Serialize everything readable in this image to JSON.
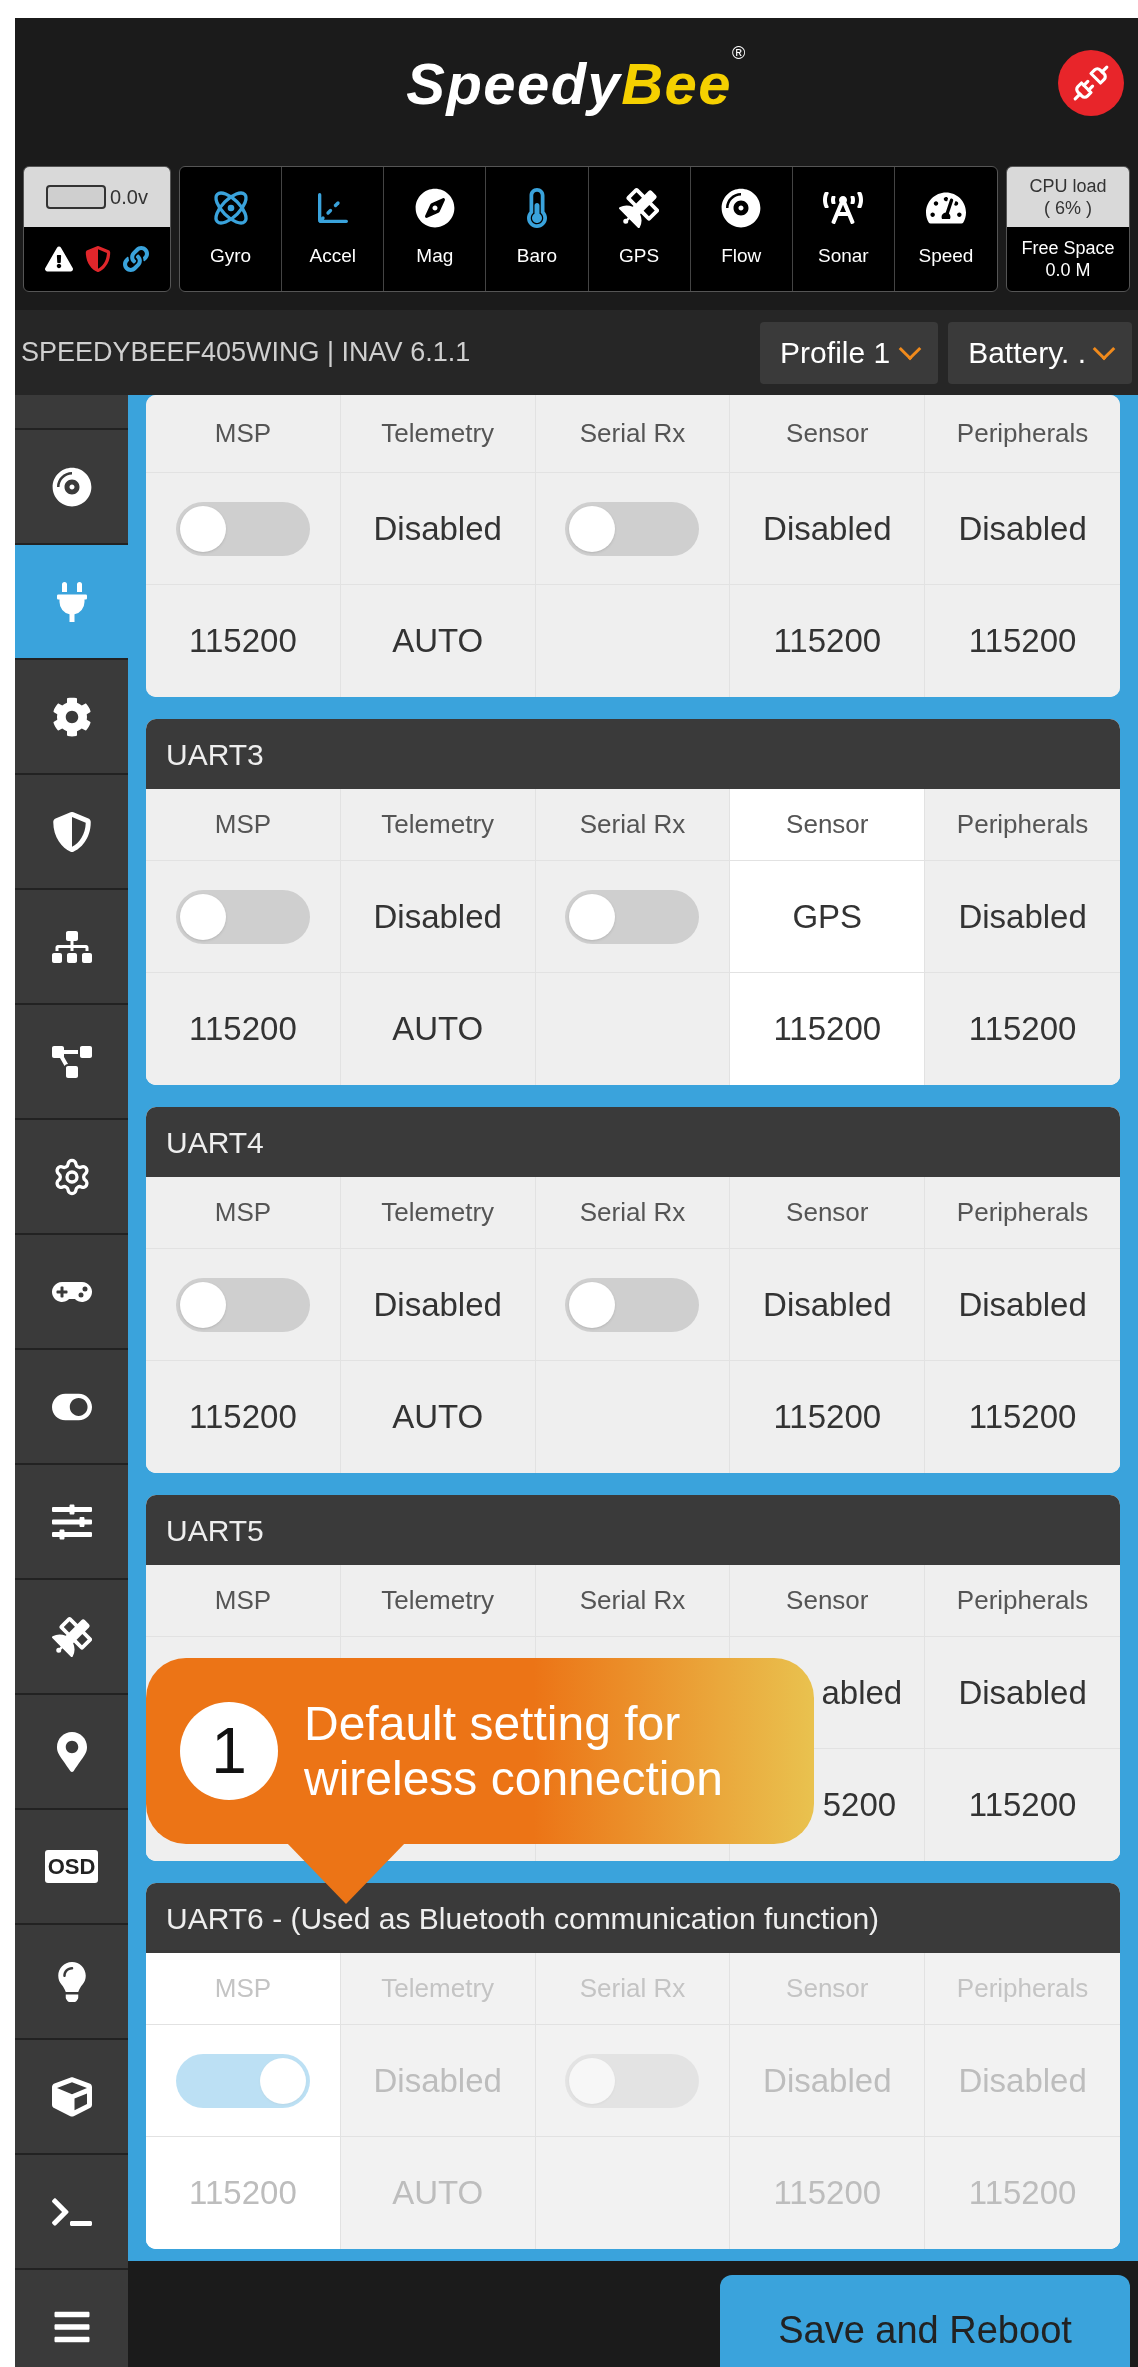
{
  "header": {
    "logo_part1": "Speedy",
    "logo_part2": "Bee",
    "logo_mark": "®"
  },
  "status": {
    "battery": "0.0v",
    "sensors": [
      {
        "label": "Gyro",
        "active": true
      },
      {
        "label": "Accel",
        "active": true
      },
      {
        "label": "Mag",
        "active": false
      },
      {
        "label": "Baro",
        "active": true
      },
      {
        "label": "GPS",
        "active": false
      },
      {
        "label": "Flow",
        "active": false
      },
      {
        "label": "Sonar",
        "active": false
      },
      {
        "label": "Speed",
        "active": false
      }
    ],
    "cpu_label": "CPU load",
    "cpu_value": "( 6% )",
    "space_label": "Free Space",
    "space_value": "0.0 M"
  },
  "board": {
    "name": "SPEEDYBEEF405WING | INAV 6.1.1",
    "profile": "Profile 1",
    "battery_profile": "Battery. ."
  },
  "sidebar": {
    "items": [
      {
        "selected": false
      },
      {
        "selected": false
      },
      {
        "selected": true
      },
      {
        "selected": false
      },
      {
        "selected": false
      },
      {
        "selected": false
      },
      {
        "selected": false
      },
      {
        "selected": false
      },
      {
        "selected": false
      },
      {
        "selected": false
      },
      {
        "selected": false
      },
      {
        "selected": false
      },
      {
        "selected": false
      },
      {
        "selected": false,
        "label": "OSD"
      },
      {
        "selected": false
      },
      {
        "selected": false
      },
      {
        "selected": false
      },
      {
        "selected": false
      }
    ]
  },
  "ports": [
    {
      "disabled": false,
      "columns": [
        {
          "header": "MSP",
          "highlighted": false,
          "kind": "toggle",
          "on": false,
          "baud": "115200"
        },
        {
          "header": "Telemetry",
          "highlighted": false,
          "kind": "text",
          "value": "Disabled",
          "baud": "AUTO"
        },
        {
          "header": "Serial Rx",
          "highlighted": false,
          "kind": "toggle",
          "on": false
        },
        {
          "header": "Sensor",
          "highlighted": false,
          "kind": "text",
          "value": "Disabled",
          "baud": "115200"
        },
        {
          "header": "Peripherals",
          "highlighted": false,
          "kind": "text",
          "value": "Disabled",
          "baud": "115200"
        }
      ]
    },
    {
      "title": "UART3",
      "disabled": false,
      "columns": [
        {
          "header": "MSP",
          "highlighted": false,
          "kind": "toggle",
          "on": false,
          "baud": "115200"
        },
        {
          "header": "Telemetry",
          "highlighted": false,
          "kind": "text",
          "value": "Disabled",
          "baud": "AUTO"
        },
        {
          "header": "Serial Rx",
          "highlighted": false,
          "kind": "toggle",
          "on": false
        },
        {
          "header": "Sensor",
          "highlighted": true,
          "kind": "text",
          "value": "GPS",
          "baud": "115200"
        },
        {
          "header": "Peripherals",
          "highlighted": false,
          "kind": "text",
          "value": "Disabled",
          "baud": "115200"
        }
      ]
    },
    {
      "title": "UART4",
      "disabled": false,
      "columns": [
        {
          "header": "MSP",
          "highlighted": false,
          "kind": "toggle",
          "on": false,
          "baud": "115200"
        },
        {
          "header": "Telemetry",
          "highlighted": false,
          "kind": "text",
          "value": "Disabled",
          "baud": "AUTO"
        },
        {
          "header": "Serial Rx",
          "highlighted": false,
          "kind": "toggle",
          "on": false
        },
        {
          "header": "Sensor",
          "highlighted": false,
          "kind": "text",
          "value": "Disabled",
          "baud": "115200"
        },
        {
          "header": "Peripherals",
          "highlighted": false,
          "kind": "text",
          "value": "Disabled",
          "baud": "115200"
        }
      ]
    },
    {
      "title": "UART5",
      "disabled": false,
      "columns": [
        {
          "header": "MSP",
          "highlighted": false,
          "kind": "none"
        },
        {
          "header": "Telemetry",
          "highlighted": false,
          "kind": "none"
        },
        {
          "header": "Serial Rx",
          "highlighted": false,
          "kind": "none"
        },
        {
          "header": "Sensor",
          "highlighted": false,
          "kind": "text",
          "value": "abled",
          "baud": "5200",
          "clipped": true
        },
        {
          "header": "Peripherals",
          "highlighted": false,
          "kind": "text",
          "value": "Disabled",
          "baud": "115200"
        }
      ]
    },
    {
      "title": "UART6 - (Used as Bluetooth communication function)",
      "disabled": true,
      "columns": [
        {
          "header": "MSP",
          "highlighted": true,
          "kind": "toggle",
          "on": true,
          "baud": "115200"
        },
        {
          "header": "Telemetry",
          "highlighted": false,
          "kind": "text",
          "value": "Disabled",
          "baud": "AUTO"
        },
        {
          "header": "Serial Rx",
          "highlighted": false,
          "kind": "toggle",
          "on": false
        },
        {
          "header": "Sensor",
          "highlighted": false,
          "kind": "text",
          "value": "Disabled",
          "baud": "115200"
        },
        {
          "header": "Peripherals",
          "highlighted": false,
          "kind": "text",
          "value": "Disabled",
          "baud": "115200"
        }
      ]
    }
  ],
  "callout": {
    "number": "1",
    "text": "Default setting for wireless connection"
  },
  "save_button": "Save and Reboot"
}
